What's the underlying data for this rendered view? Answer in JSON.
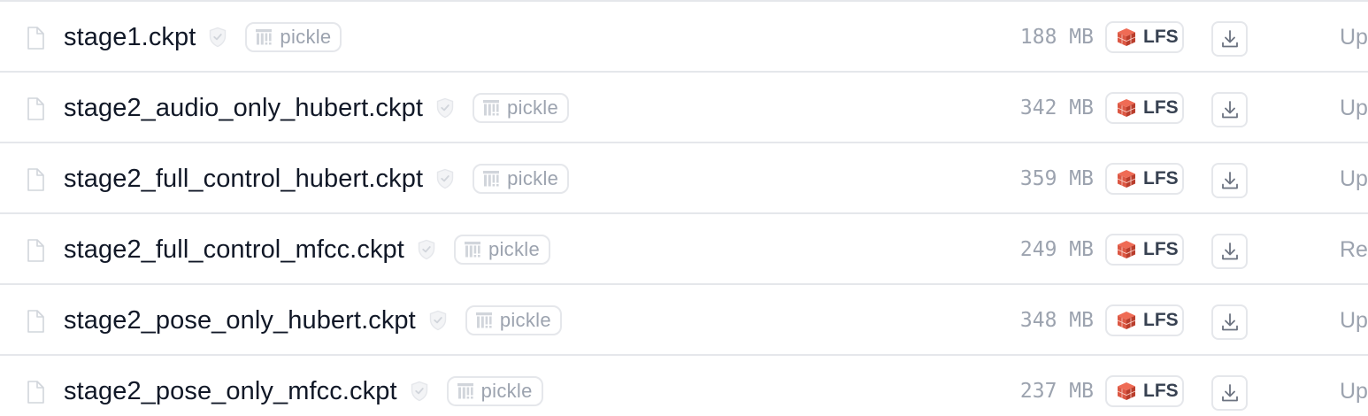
{
  "files": [
    {
      "name": "stage1.ckpt",
      "badge": "pickle",
      "size": "188 MB",
      "storage": "LFS",
      "commit": "Up"
    },
    {
      "name": "stage2_audio_only_hubert.ckpt",
      "badge": "pickle",
      "size": "342 MB",
      "storage": "LFS",
      "commit": "Up"
    },
    {
      "name": "stage2_full_control_hubert.ckpt",
      "badge": "pickle",
      "size": "359 MB",
      "storage": "LFS",
      "commit": "Up"
    },
    {
      "name": "stage2_full_control_mfcc.ckpt",
      "badge": "pickle",
      "size": "249 MB",
      "storage": "LFS",
      "commit": "Re"
    },
    {
      "name": "stage2_pose_only_hubert.ckpt",
      "badge": "pickle",
      "size": "348 MB",
      "storage": "LFS",
      "commit": "Up"
    },
    {
      "name": "stage2_pose_only_mfcc.ckpt",
      "badge": "pickle",
      "size": "237 MB",
      "storage": "LFS",
      "commit": "Up"
    }
  ],
  "icons": {
    "file": "file-icon",
    "safety": "shield-check-icon",
    "pickle": "pickle-icon",
    "lfs": "lfs-brick-icon",
    "download": "download-icon"
  },
  "colors": {
    "lfs_brick": "#dc5743",
    "border": "#e5e7eb",
    "muted_text": "#9ca3af"
  }
}
